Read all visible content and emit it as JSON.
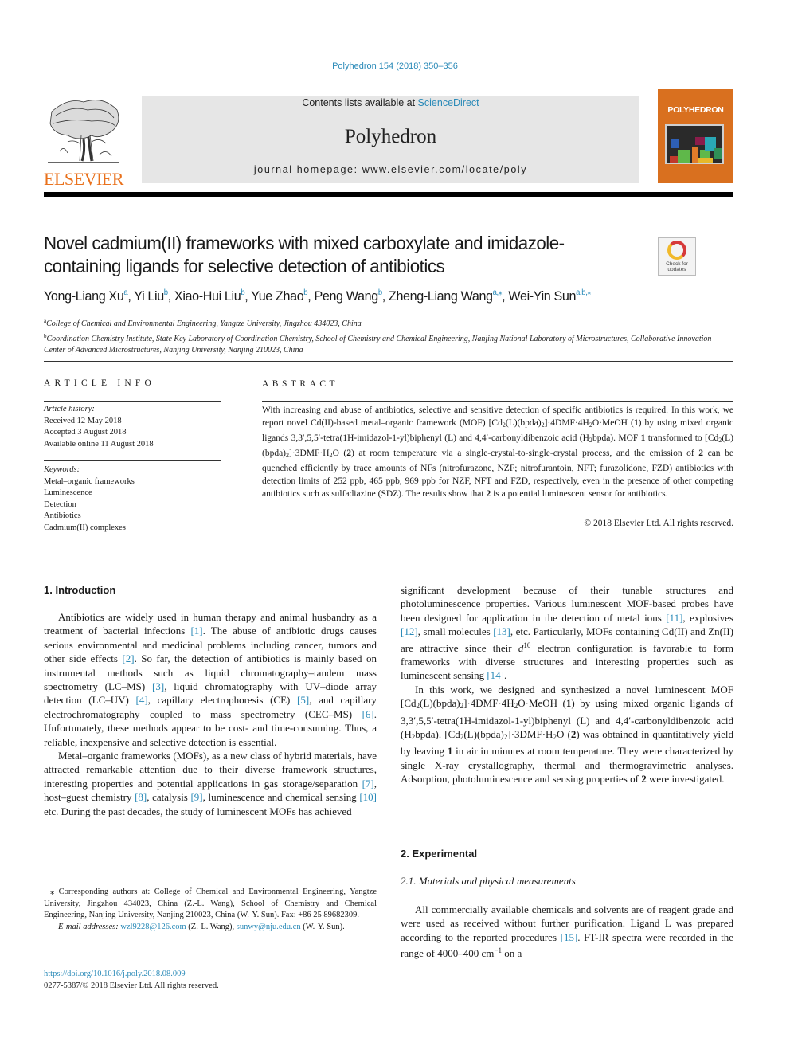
{
  "header": {
    "journal_ref": "Polyhedron 154 (2018) 350–356",
    "contents_prefix": "Contents lists available at ",
    "contents_link": "ScienceDirect",
    "journal_title": "Polyhedron",
    "homepage": "journal homepage: www.elsevier.com/locate/poly",
    "publisher_logo": "ELSEVIER",
    "cover_title": "POLYHEDRON",
    "check_updates": "Check for updates"
  },
  "article": {
    "title": "Novel cadmium(II) frameworks with mixed carboxylate and imidazole-containing ligands for selective detection of antibiotics",
    "authors": [
      {
        "name": "Yong-Liang Xu",
        "aff": "a"
      },
      {
        "name": "Yi Liu",
        "aff": "b"
      },
      {
        "name": "Xiao-Hui Liu",
        "aff": "b"
      },
      {
        "name": "Yue Zhao",
        "aff": "b"
      },
      {
        "name": "Peng Wang",
        "aff": "b"
      },
      {
        "name": "Zheng-Liang Wang",
        "aff": "a,⁎"
      },
      {
        "name": "Wei-Yin Sun",
        "aff": "a,b,⁎"
      }
    ],
    "affiliations": [
      {
        "key": "a",
        "text": "College of Chemical and Environmental Engineering, Yangtze University, Jingzhou 434023, China"
      },
      {
        "key": "b",
        "text": "Coordination Chemistry Institute, State Key Laboratory of Coordination Chemistry, School of Chemistry and Chemical Engineering, Nanjing National Laboratory of Microstructures, Collaborative Innovation Center of Advanced Microstructures, Nanjing University, Nanjing 210023, China"
      }
    ]
  },
  "article_info": {
    "heading": "ARTICLE INFO",
    "history_label": "Article history:",
    "history": [
      "Received 12 May 2018",
      "Accepted 3 August 2018",
      "Available online 11 August 2018"
    ],
    "keywords_label": "Keywords:",
    "keywords": [
      "Metal–organic frameworks",
      "Luminescence",
      "Detection",
      "Antibiotics",
      "Cadmium(II) complexes"
    ]
  },
  "abstract": {
    "heading": "ABSTRACT",
    "p1": "With increasing and abuse of antibiotics, selective and sensitive detection of specific antibiotics is required. In this work, we report novel Cd(II)-based metal–organic framework (MOF) [Cd",
    "p2": "(L)(bpda)",
    "p3": "]·4DMF·4H",
    "p4": "O·MeOH (",
    "p5": "1",
    "p6": ") by using mixed organic ligands 3,3′,5,5′-tetra(1H-imidazol-1-yl)biphenyl (L) and 4,4′-carbonyldibenzoic acid (H",
    "p7": "bpda). MOF ",
    "p8": "1",
    "p9": " transformed to [Cd",
    "p10": "(L)(bpda)",
    "p11": "]·3DMF·H",
    "p12": "O (",
    "p13": "2",
    "p14": ") at room temperature via a single-crystal-to-single-crystal process, and the emission of ",
    "p15": "2",
    "p16": " can be quenched efficiently by trace amounts of NFs (nitrofurazone, NZF; nitrofurantoin, NFT; furazolidone, FZD) antibiotics with detection limits of 252 ppb, 465 ppb, 969 ppb for NZF, NFT and FZD, respectively, even in the presence of other competing antibiotics such as sulfadiazine (SDZ). The results show that ",
    "p17": "2",
    "p18": " is a potential luminescent sensor for antibiotics.",
    "copyright": "© 2018 Elsevier Ltd. All rights reserved."
  },
  "body": {
    "intro_heading": "1. Introduction",
    "intro_p1": [
      "Antibiotics are widely used in human therapy and animal husbandry as a treatment of bacterial infections ",
      "[1]",
      ". The abuse of antibiotic drugs causes serious environmental and medicinal problems including cancer, tumors and other side effects ",
      "[2]",
      ". So far, the detection of antibiotics is mainly based on instrumental methods such as liquid chromatography–tandem mass spectrometry (LC–MS) ",
      "[3]",
      ", liquid chromatography with UV–diode array detection (LC–UV) ",
      "[4]",
      ", capillary electrophoresis (CE) ",
      "[5]",
      ", and capillary electrochromatography coupled to mass spectrometry (CEC–MS) ",
      "[6]",
      ". Unfortunately, these methods appear to be cost- and time-consuming. Thus, a reliable, inexpensive and selective detection is essential."
    ],
    "intro_p2": [
      "Metal–organic frameworks (MOFs), as a new class of hybrid materials, have attracted remarkable attention due to their diverse framework structures, interesting properties and potential applications in gas storage/separation ",
      "[7]",
      ", host–guest chemistry ",
      "[8]",
      ", catalysis ",
      "[9]",
      ", luminescence and chemical sensing ",
      "[10]",
      " etc. During the past decades, the study of luminescent MOFs has achieved"
    ],
    "intro_p2_cont": [
      "significant development because of their tunable structures and photoluminescence properties. Various luminescent MOF-based probes have been designed for application in the detection of metal ions ",
      "[11]",
      ", explosives ",
      "[12]",
      ", small molecules ",
      "[13]",
      ", etc. Particularly, MOFs containing Cd(II) and Zn(II) are attractive since their d",
      "10",
      " electron configuration is favorable to form frameworks with diverse structures and interesting properties such as luminescent sensing ",
      "[14]",
      "."
    ],
    "intro_p3": {
      "a": "In this work, we designed and synthesized a novel luminescent MOF [Cd",
      "b": "(L)(bpda)",
      "c": "]·4DMF·4H",
      "d": "O·MeOH (",
      "e": "1",
      "f": ") by using mixed organic ligands of 3,3′,5,5′-tetra(1H-imidazol-1-yl)biphenyl (L) and 4,4′-carbonyldibenzoic acid (H",
      "g": "bpda). [Cd",
      "h": "(L)(bpda)",
      "i": "]·3DMF·H",
      "j": "O (",
      "k": "2",
      "l": ") was obtained in quantitatively yield by leaving ",
      "m": "1",
      "n": " in air in minutes at room temperature. They were characterized by single X-ray crystallography, thermal and thermogravimetric analyses. Adsorption, photoluminescence and sensing properties of ",
      "o": "2",
      "p": " were investigated."
    },
    "exp_heading": "2. Experimental",
    "exp_subheading": "2.1. Materials and physical measurements",
    "exp_p1": [
      "All commercially available chemicals and solvents are of reagent grade and were used as received without further purification. Ligand L was prepared according to the reported procedures ",
      "[15]",
      ". FT-IR spectra were recorded in the range of 4000–400 cm",
      "−1",
      " on a"
    ]
  },
  "footnotes": {
    "corresponding": "⁎ Corresponding authors at: College of Chemical and Environmental Engineering, Yangtze University, Jingzhou 434023, China (Z.-L. Wang), School of Chemistry and Chemical Engineering, Nanjing University, Nanjing 210023, China (W.-Y. Sun). Fax: +86 25 89682309.",
    "email_label": "E-mail addresses:",
    "email1": "wzl9228@126.com",
    "email1_owner": " (Z.-L. Wang), ",
    "email2": "sunwy@nju.edu.cn",
    "email2_owner": " (W.-Y. Sun).",
    "doi": "https://doi.org/10.1016/j.poly.2018.08.009",
    "issn": "0277-5387/© 2018 Elsevier Ltd. All rights reserved."
  },
  "colors": {
    "link": "#2a8ab8",
    "elsevier_orange": "#e9711c",
    "cover_orange": "#d9701f",
    "masthead_gray": "#e6e6e6"
  }
}
